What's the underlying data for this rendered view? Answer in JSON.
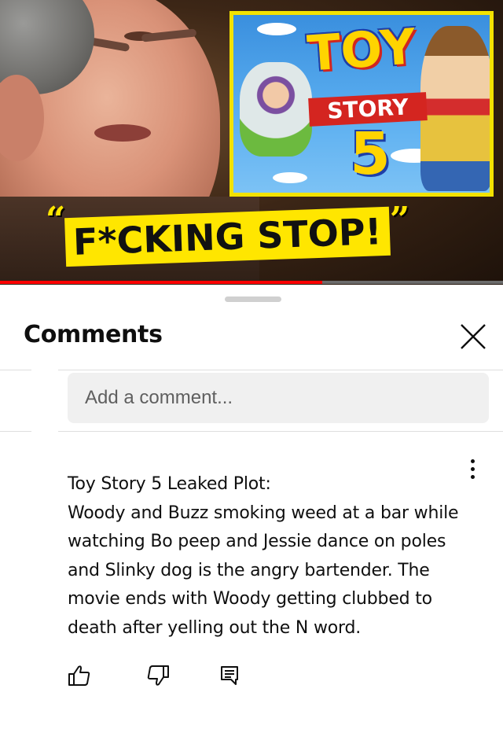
{
  "video": {
    "poster": {
      "logo_top": "TOY",
      "logo_mid": "STORY",
      "logo_num": "5"
    },
    "caption": {
      "open_quote": "“",
      "text": "F*CKING STOP!",
      "close_quote": "”"
    },
    "progress": 0.64
  },
  "sheet": {
    "title": "Comments",
    "close_icon": "close-icon",
    "input": {
      "placeholder": "Add a comment...",
      "value": ""
    },
    "comment": {
      "menu_icon": "more-vert-icon",
      "lines": [
        "Toy Story 5 Leaked Plot:",
        "Woody and Buzz smoking weed at a bar while",
        "watching Bo peep and Jessie dance on poles",
        "and Slinky dog is the angry bartender. The",
        "movie ends with Woody getting clubbed to",
        "death after yelling out the N word."
      ],
      "actions": [
        "like-icon",
        "dislike-icon",
        "reply-icon"
      ]
    }
  }
}
